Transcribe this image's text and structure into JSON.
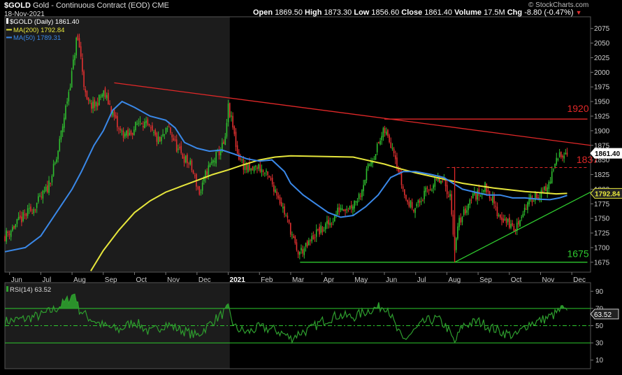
{
  "header": {
    "symbol": "$GOLD",
    "name": "Gold - Continuous Contract (EOD)",
    "exchange": "CME",
    "date": "18-Nov-2021",
    "open_label": "Open",
    "open": "1869.50",
    "high_label": "High",
    "high": "1873.30",
    "low_label": "Low",
    "low": "1856.60",
    "close_label": "Close",
    "close": "1861.40",
    "volume_label": "Volume",
    "volume": "17.5M",
    "chg_label": "Chg",
    "chg": "-8.80 (-0.47%)",
    "brand": "© StockCharts.com"
  },
  "colors": {
    "background": "#000000",
    "up": "#2fbf2f",
    "down": "#e03030",
    "ma200": "#e6e63c",
    "ma50": "#3a88e8",
    "trend_red": "#e02828",
    "trend_green": "#2ec82e",
    "rsi": "#2e9e2e"
  },
  "chart_data": [
    {
      "type": "candlestick",
      "legend": [
        "$GOLD (Daily) 1861.40",
        "MA(200) 1792.84",
        "MA(50) 1789.31"
      ],
      "x_labels": [
        "Jun",
        "Jul",
        "Aug",
        "Sep",
        "Oct",
        "Nov",
        "Dec",
        "2021",
        "Feb",
        "Mar",
        "Apr",
        "May",
        "Jun",
        "Jul",
        "Aug",
        "Sep",
        "Oct",
        "Nov",
        "Dec"
      ],
      "x_label_months": [
        0,
        1,
        2,
        3,
        4,
        5,
        6,
        7,
        8,
        9,
        10,
        11,
        12,
        13,
        14,
        15,
        16,
        17,
        18
      ],
      "y_ticks": [
        1675,
        1700,
        1725,
        1750,
        1775,
        1800,
        1825,
        1850,
        1875,
        1900,
        1925,
        1950,
        1975,
        2000,
        2025,
        2050,
        2075
      ],
      "ylim": [
        1658,
        2095
      ],
      "xlim": [
        -0.15,
        18.6
      ],
      "shaded_region_months": [
        -0.15,
        7.05
      ],
      "price_path": [
        [
          -0.15,
          1720
        ],
        [
          0.3,
          1745
        ],
        [
          0.8,
          1770
        ],
        [
          1.2,
          1800
        ],
        [
          1.5,
          1850
        ],
        [
          1.8,
          1940
        ],
        [
          2.0,
          2000
        ],
        [
          2.15,
          2060
        ],
        [
          2.25,
          2040
        ],
        [
          2.45,
          1950
        ],
        [
          2.7,
          1940
        ],
        [
          3.0,
          1965
        ],
        [
          3.2,
          1945
        ],
        [
          3.5,
          1900
        ],
        [
          3.8,
          1890
        ],
        [
          4.2,
          1920
        ],
        [
          4.5,
          1900
        ],
        [
          4.8,
          1880
        ],
        [
          5.1,
          1905
        ],
        [
          5.4,
          1865
        ],
        [
          5.8,
          1840
        ],
        [
          6.1,
          1790
        ],
        [
          6.3,
          1830
        ],
        [
          6.6,
          1855
        ],
        [
          6.9,
          1880
        ],
        [
          7.0,
          1940
        ],
        [
          7.15,
          1905
        ],
        [
          7.3,
          1860
        ],
        [
          7.5,
          1840
        ],
        [
          7.7,
          1830
        ],
        [
          7.95,
          1840
        ],
        [
          8.2,
          1825
        ],
        [
          8.4,
          1810
        ],
        [
          8.6,
          1790
        ],
        [
          8.8,
          1760
        ],
        [
          9.0,
          1730
        ],
        [
          9.2,
          1690
        ],
        [
          9.5,
          1700
        ],
        [
          9.8,
          1725
        ],
        [
          10.0,
          1730
        ],
        [
          10.3,
          1745
        ],
        [
          10.6,
          1770
        ],
        [
          10.9,
          1770
        ],
        [
          11.2,
          1790
        ],
        [
          11.5,
          1840
        ],
        [
          11.8,
          1875
        ],
        [
          12.0,
          1900
        ],
        [
          12.15,
          1885
        ],
        [
          12.3,
          1870
        ],
        [
          12.5,
          1820
        ],
        [
          12.7,
          1780
        ],
        [
          12.9,
          1770
        ],
        [
          13.1,
          1775
        ],
        [
          13.4,
          1800
        ],
        [
          13.7,
          1815
        ],
        [
          13.9,
          1810
        ],
        [
          14.1,
          1790
        ],
        [
          14.25,
          1700
        ],
        [
          14.4,
          1745
        ],
        [
          14.6,
          1765
        ],
        [
          14.8,
          1790
        ],
        [
          15.0,
          1790
        ],
        [
          15.2,
          1805
        ],
        [
          15.4,
          1790
        ],
        [
          15.6,
          1760
        ],
        [
          15.8,
          1750
        ],
        [
          16.0,
          1740
        ],
        [
          16.2,
          1730
        ],
        [
          16.4,
          1760
        ],
        [
          16.6,
          1775
        ],
        [
          16.8,
          1790
        ],
        [
          17.0,
          1790
        ],
        [
          17.2,
          1800
        ],
        [
          17.4,
          1830
        ],
        [
          17.6,
          1860
        ],
        [
          17.75,
          1865
        ],
        [
          17.85,
          1860
        ]
      ],
      "ma200": [
        [
          2.6,
          1660
        ],
        [
          3.0,
          1695
        ],
        [
          3.5,
          1730
        ],
        [
          4.0,
          1760
        ],
        [
          4.5,
          1780
        ],
        [
          5.0,
          1795
        ],
        [
          5.5,
          1805
        ],
        [
          6.0,
          1815
        ],
        [
          6.5,
          1825
        ],
        [
          7.0,
          1833
        ],
        [
          7.5,
          1842
        ],
        [
          8.0,
          1850
        ],
        [
          8.5,
          1855
        ],
        [
          9.0,
          1857
        ],
        [
          10.0,
          1856
        ],
        [
          11.0,
          1855
        ],
        [
          12.0,
          1843
        ],
        [
          12.5,
          1835
        ],
        [
          13.0,
          1828
        ],
        [
          13.5,
          1822
        ],
        [
          14.0,
          1816
        ],
        [
          14.5,
          1810
        ],
        [
          15.0,
          1806
        ],
        [
          15.5,
          1802
        ],
        [
          16.0,
          1799
        ],
        [
          16.5,
          1796
        ],
        [
          17.0,
          1794
        ],
        [
          17.5,
          1792
        ],
        [
          17.85,
          1792.84
        ]
      ],
      "ma50": [
        [
          -0.15,
          1693
        ],
        [
          0.5,
          1700
        ],
        [
          1.0,
          1720
        ],
        [
          1.5,
          1760
        ],
        [
          2.0,
          1800
        ],
        [
          2.3,
          1830
        ],
        [
          2.7,
          1875
        ],
        [
          3.0,
          1900
        ],
        [
          3.3,
          1935
        ],
        [
          3.6,
          1950
        ],
        [
          4.0,
          1940
        ],
        [
          4.5,
          1925
        ],
        [
          5.0,
          1918
        ],
        [
          5.3,
          1905
        ],
        [
          5.6,
          1880
        ],
        [
          6.0,
          1870
        ],
        [
          6.4,
          1865
        ],
        [
          6.8,
          1867
        ],
        [
          7.2,
          1860
        ],
        [
          7.6,
          1852
        ],
        [
          8.0,
          1848
        ],
        [
          8.4,
          1850
        ],
        [
          8.8,
          1830
        ],
        [
          9.0,
          1810
        ],
        [
          9.4,
          1790
        ],
        [
          9.8,
          1775
        ],
        [
          10.2,
          1760
        ],
        [
          10.6,
          1752
        ],
        [
          11.0,
          1755
        ],
        [
          11.4,
          1770
        ],
        [
          11.8,
          1790
        ],
        [
          12.2,
          1820
        ],
        [
          12.6,
          1830
        ],
        [
          13.0,
          1830
        ],
        [
          13.5,
          1825
        ],
        [
          13.9,
          1820
        ],
        [
          14.2,
          1810
        ],
        [
          14.5,
          1800
        ],
        [
          14.9,
          1795
        ],
        [
          15.3,
          1790
        ],
        [
          15.7,
          1790
        ],
        [
          16.1,
          1785
        ],
        [
          16.5,
          1785
        ],
        [
          16.9,
          1783
        ],
        [
          17.3,
          1782
        ],
        [
          17.6,
          1785
        ],
        [
          17.85,
          1789.31
        ]
      ],
      "annotations": [
        {
          "kind": "line",
          "color": "trend_red",
          "from": [
            3.35,
            1982
          ],
          "to": [
            18.6,
            1875
          ]
        },
        {
          "kind": "line",
          "color": "trend_red",
          "from": [
            12.0,
            1920
          ],
          "to": [
            18.5,
            1920
          ]
        },
        {
          "kind": "dash",
          "color": "trend_red",
          "from": [
            14.0,
            1837
          ],
          "to": [
            18.5,
            1837
          ]
        },
        {
          "kind": "line",
          "color": "trend_green",
          "from": [
            9.3,
            1675
          ],
          "to": [
            18.5,
            1675
          ]
        },
        {
          "kind": "line",
          "color": "trend_green",
          "from": [
            14.25,
            1675
          ],
          "to": [
            18.6,
            1795
          ]
        },
        {
          "kind": "line",
          "color": "trend_red",
          "from": [
            14.25,
            1675
          ],
          "to": [
            14.25,
            1838
          ]
        }
      ],
      "labels": [
        {
          "text": "1920",
          "x": 17.85,
          "y": 1932,
          "color": "trend_red"
        },
        {
          "text": "1837",
          "x": 18.15,
          "y": 1845,
          "color": "trend_red"
        },
        {
          "text": "1675",
          "x": 17.85,
          "y": 1684,
          "color": "trend_green"
        }
      ],
      "price_tags": [
        {
          "text": "1861.40",
          "y": 1861.4,
          "color": "#ffffff"
        },
        {
          "text": "1792.84",
          "y": 1792.84,
          "color": "#e6e63c"
        }
      ]
    },
    {
      "type": "line",
      "legend": "RSI(14) 63.52",
      "y_ticks": [
        10,
        30,
        50,
        70,
        90
      ],
      "ylim": [
        0,
        100
      ],
      "bands": [
        30,
        50,
        70
      ],
      "last_value": "63.52",
      "rsi_path": [
        [
          -0.15,
          55
        ],
        [
          0.5,
          58
        ],
        [
          1.0,
          62
        ],
        [
          1.5,
          70
        ],
        [
          1.8,
          78
        ],
        [
          2.0,
          85
        ],
        [
          2.1,
          88
        ],
        [
          2.2,
          70
        ],
        [
          2.5,
          60
        ],
        [
          3.0,
          50
        ],
        [
          3.5,
          45
        ],
        [
          4.0,
          55
        ],
        [
          4.5,
          42
        ],
        [
          5.0,
          52
        ],
        [
          5.5,
          45
        ],
        [
          6.0,
          38
        ],
        [
          6.5,
          55
        ],
        [
          6.9,
          66
        ],
        [
          7.0,
          70
        ],
        [
          7.2,
          48
        ],
        [
          7.6,
          42
        ],
        [
          8.0,
          48
        ],
        [
          8.5,
          45
        ],
        [
          8.8,
          40
        ],
        [
          9.0,
          35
        ],
        [
          9.3,
          42
        ],
        [
          9.6,
          45
        ],
        [
          10.0,
          55
        ],
        [
          10.5,
          62
        ],
        [
          11.0,
          60
        ],
        [
          11.5,
          68
        ],
        [
          11.9,
          72
        ],
        [
          12.1,
          72
        ],
        [
          12.4,
          45
        ],
        [
          12.6,
          33
        ],
        [
          12.9,
          42
        ],
        [
          13.3,
          55
        ],
        [
          13.7,
          58
        ],
        [
          14.0,
          48
        ],
        [
          14.25,
          30
        ],
        [
          14.5,
          50
        ],
        [
          15.0,
          55
        ],
        [
          15.4,
          48
        ],
        [
          15.8,
          42
        ],
        [
          16.2,
          38
        ],
        [
          16.6,
          52
        ],
        [
          17.0,
          56
        ],
        [
          17.4,
          62
        ],
        [
          17.7,
          70
        ],
        [
          17.85,
          63.52
        ]
      ]
    }
  ]
}
